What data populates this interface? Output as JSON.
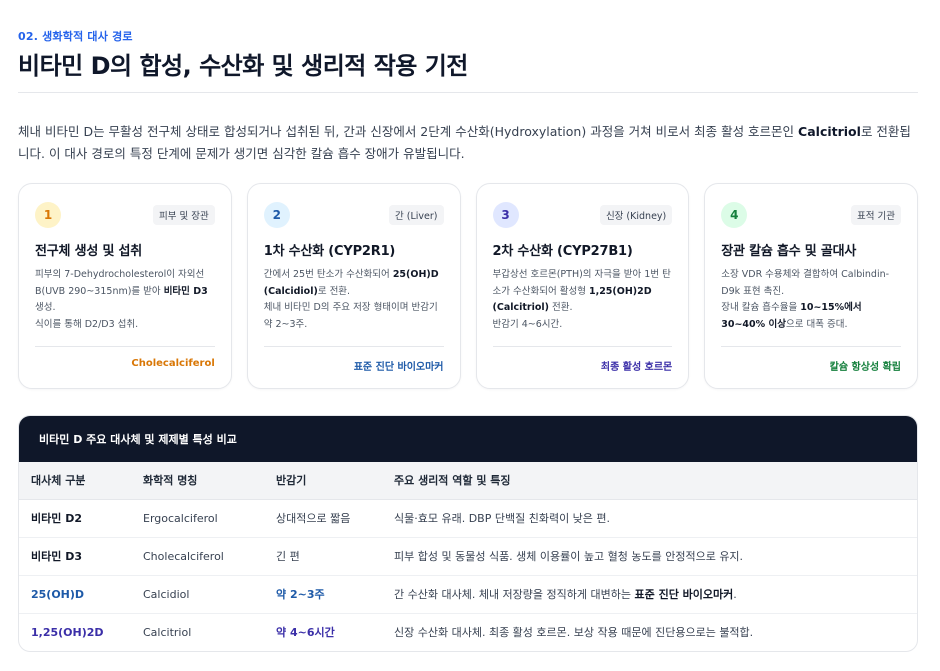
{
  "header": {
    "eyebrow": "02. 생화학적 대사 경로",
    "title": "비타민 D의 합성, 수산화 및 생리적 작용 기전"
  },
  "intro": {
    "part1": "체내 비타민 D는 무활성 전구체 상태로 합성되거나 섭취된 뒤, 간과 신장에서 2단계 수산화(Hydroxylation) 과정을 거쳐 비로서 최종 활성 호르몬인 ",
    "bold": "Calcitriol",
    "part2": "로 전환됩니다. 이 대사 경로의 특정 단계에 문제가 생기면 심각한 칼슘 흡수 장애가 유발됩니다."
  },
  "cards": [
    {
      "step": "1",
      "tag": "피부 및 장관",
      "title": "전구체 생성 및 섭취",
      "desc1": "피부의 7-Dehydrocholesterol이 자외선 B(UVB 290~315nm)를 받아 ",
      "desc_bold": "비타민 D3",
      "desc2": " 생성.",
      "desc3": "식이를 통해 D2/D3 섭취.",
      "footer": "Cholecalciferol",
      "color": "#d97706",
      "bg": "#fef3c7"
    },
    {
      "step": "2",
      "tag": "간 (Liver)",
      "title": "1차 수산화 (CYP2R1)",
      "desc1": "간에서 25번 탄소가 수산화되어 ",
      "desc_bold": "25(OH)D (Calcidiol)",
      "desc2": "로 전환.",
      "desc3": "체내 비타민 D의 주요 저장 형태이며 반감기 약 2~3주.",
      "footer": "표준 진단 바이오마커",
      "color": "#1e5aa8",
      "bg": "#e0f2fe"
    },
    {
      "step": "3",
      "tag": "신장 (Kidney)",
      "title": "2차 수산화 (CYP27B1)",
      "desc1": "부갑상선 호르몬(PTH)의 자극을 받아 1번 탄소가 수산화되어 활성형 ",
      "desc_bold": "1,25(OH)2D (Calcitriol)",
      "desc2": " 전환.",
      "desc3": "반감기 4~6시간.",
      "footer": "최종 활성 호르몬",
      "color": "#3b2fa8",
      "bg": "#e0e7ff"
    },
    {
      "step": "4",
      "tag": "표적 기관",
      "title": "장관 칼슘 흡수 및 골대사",
      "desc1": "소장 VDR 수용체와 결합하여 Calbindin-D9k 표현 촉진.",
      "desc_bold": "",
      "desc2": "",
      "desc3_pre": "장내 칼슘 흡수율을 ",
      "desc3_bold": "10~15%에서 30~40% 이상",
      "desc3_post": "으로 대폭 증대.",
      "footer": "칼슘 항상성 확립",
      "color": "#15803d",
      "bg": "#dcfce7"
    }
  ],
  "table": {
    "heading": "비타민 D 주요 대사체 및 제제별 특성 비교",
    "columns": [
      "대사체 구분",
      "화학적 명칭",
      "반감기",
      "주요 생리적 역할 및 특징"
    ],
    "rows": [
      {
        "name": "비타민 D2",
        "chem": "Ergocalciferol",
        "half": "상대적으로 짧음",
        "role_pre": "식물·효모 유래. DBP 단백질 친화력이 낮은 편.",
        "role_bold": "",
        "role_post": ""
      },
      {
        "name": "비타민 D3",
        "chem": "Cholecalciferol",
        "half": "긴 편",
        "role_pre": "피부 합성 및 동물성 식품. 생체 이용률이 높고 혈청 농도를 안정적으로 유지.",
        "role_bold": "",
        "role_post": ""
      },
      {
        "name": "25(OH)D",
        "chem": "Calcidiol",
        "half": "약 2~3주",
        "role_pre": "간 수산화 대사체. 체내 저장량을 정직하게 대변하는 ",
        "role_bold": "표준 진단 바이오마커",
        "role_post": "."
      },
      {
        "name": "1,25(OH)2D",
        "chem": "Calcitriol",
        "half": "약 4~6시간",
        "role_pre": "신장 수산화 대사체. 최종 활성 호르몬. 보상 작용 때문에 진단용으로는 불적합.",
        "role_bold": "",
        "role_post": ""
      }
    ]
  }
}
